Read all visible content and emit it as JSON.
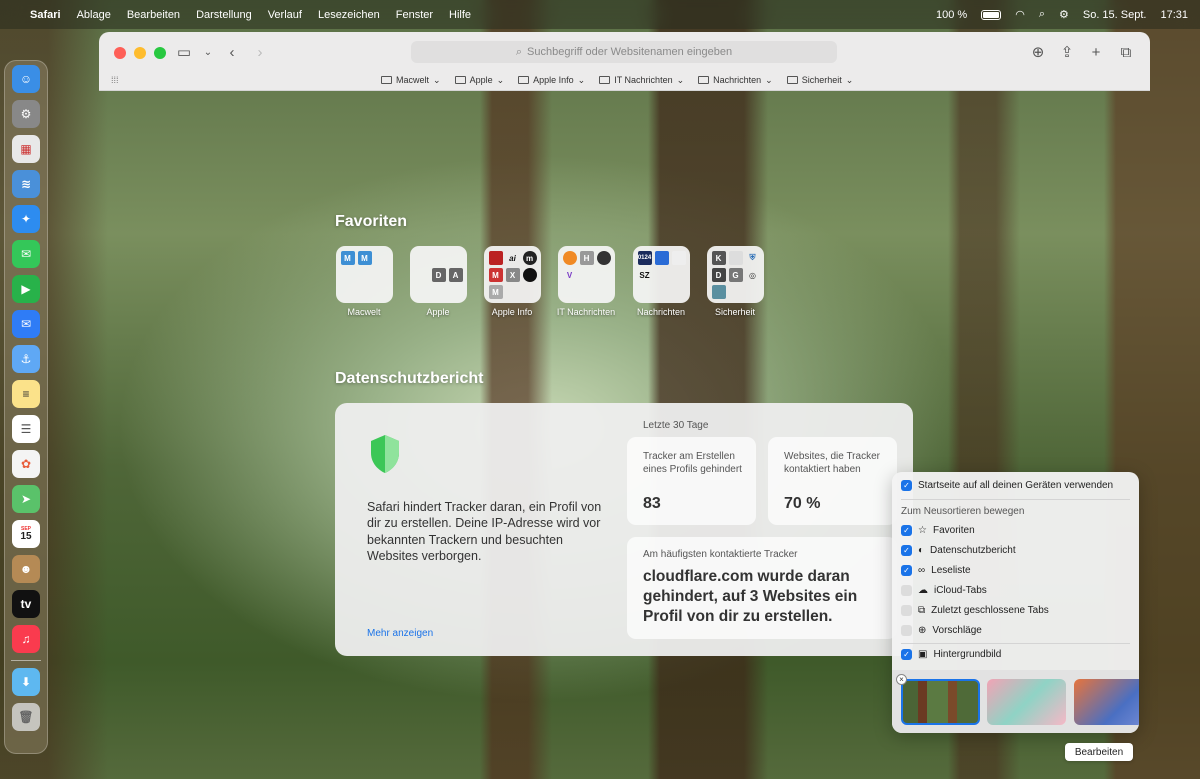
{
  "menubar": {
    "app": "Safari",
    "items": [
      "Ablage",
      "Bearbeiten",
      "Darstellung",
      "Verlauf",
      "Lesezeichen",
      "Fenster",
      "Hilfe"
    ],
    "battery": "100 %",
    "date": "So. 15. Sept.",
    "time": "17:31"
  },
  "toolbar": {
    "search_placeholder": "Suchbegriff oder Websitenamen eingeben"
  },
  "bookmarks": [
    "Macwelt",
    "Apple",
    "Apple Info",
    "IT Nachrichten",
    "Nachrichten",
    "Sicherheit"
  ],
  "favorites": {
    "title": "Favoriten",
    "items": [
      {
        "label": "Macwelt",
        "tiles": [
          "M",
          "M"
        ]
      },
      {
        "label": "Apple",
        "tiles": [
          "",
          "",
          "",
          "",
          "D",
          "A",
          ""
        ]
      },
      {
        "label": "Apple Info",
        "tiles": [
          "",
          "ai",
          "m",
          "M",
          "X",
          "",
          "M"
        ]
      },
      {
        "label": "IT Nachrichten",
        "tiles": [
          "",
          "H",
          "",
          "V"
        ]
      },
      {
        "label": "Nachrichten",
        "tiles": [
          "0124",
          "",
          "",
          "SZ"
        ]
      },
      {
        "label": "Sicherheit",
        "tiles": [
          "K",
          "",
          "",
          "D",
          "G",
          "",
          ""
        ]
      }
    ]
  },
  "privacy": {
    "title": "Datenschutzbericht",
    "description": "Safari hindert Tracker daran, ein Profil von dir zu erstellen. Deine IP-Adresse wird vor bekannten Trackern und besuchten Websites verborgen.",
    "more_link": "Mehr anzeigen",
    "period": "Letzte 30 Tage",
    "card1": {
      "label": "Tracker am Erstellen eines Profils gehindert",
      "value": "83"
    },
    "card2": {
      "label": "Websites, die Tracker kontaktiert haben",
      "value": "70 %"
    },
    "card3": {
      "label": "Am häufigsten kontaktierte Tracker",
      "text": "cloudflare.com wurde daran gehindert, auf 3 Websites ein Profil von dir zu erstellen."
    }
  },
  "popup": {
    "top_option": "Startseite auf all deinen Geräten verwenden",
    "group_label": "Zum Neusortieren bewegen",
    "options": [
      {
        "label": "Favoriten",
        "checked": true,
        "icon": "star-icon"
      },
      {
        "label": "Datenschutzbericht",
        "checked": true,
        "icon": "shield-icon"
      },
      {
        "label": "Leseliste",
        "checked": true,
        "icon": "glasses-icon"
      },
      {
        "label": "iCloud-Tabs",
        "checked": false,
        "icon": "cloud-icon"
      },
      {
        "label": "Zuletzt geschlossene Tabs",
        "checked": false,
        "icon": "tabs-icon"
      },
      {
        "label": "Vorschläge",
        "checked": false,
        "icon": "globe-icon"
      }
    ],
    "background_option": "Hintergrundbild"
  },
  "edit_button": "Bearbeiten",
  "dock": {
    "calendar_month": "SEP",
    "calendar_day": "15"
  }
}
